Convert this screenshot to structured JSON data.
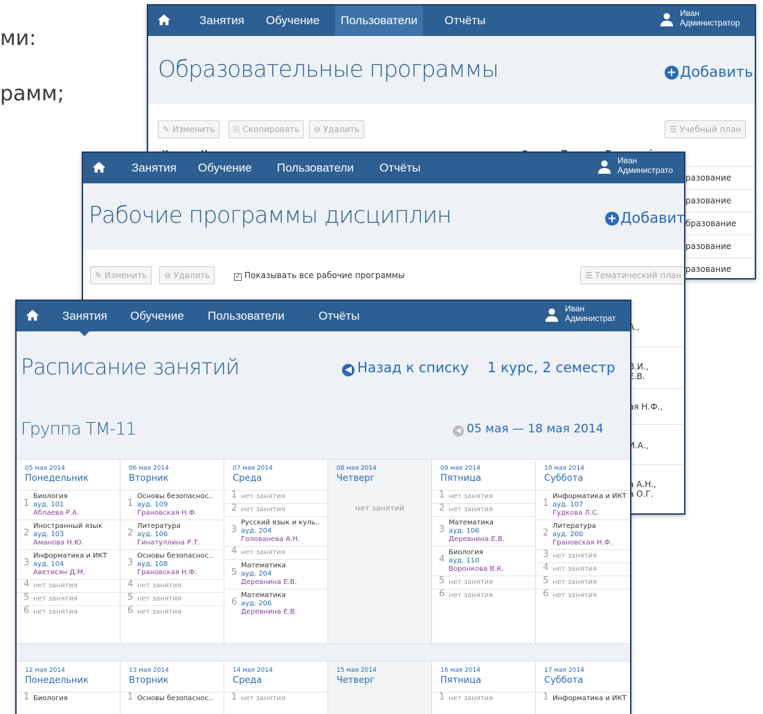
{
  "background": {
    "line1": "ми:",
    "line2": "рамм;"
  },
  "nav": {
    "items": [
      "Занятия",
      "Обучение",
      "Пользователи",
      "Отчёты"
    ],
    "user_first": "Иван",
    "user_second": "Администратор",
    "user_second_short": "Администрат",
    "user_second_mid": "Администрато"
  },
  "win1": {
    "title": "Образовательные программы",
    "add": "Добавить",
    "btn_edit": "Изменить",
    "btn_copy": "Скопировать",
    "btn_delete": "Удалить",
    "btn_plan": "Учебный план",
    "headers": {
      "code": "Код",
      "name": "Название программы",
      "form": "Форма",
      "prep": "Подгот.",
      "base": "База приёма"
    },
    "rows": [
      "разование",
      "разование",
      "бразование",
      "разование",
      "разование"
    ]
  },
  "win2": {
    "title": "Рабочие программы дисциплин",
    "add": "Добавить",
    "btn_edit": "Изменить",
    "btn_delete": "Удалить",
    "checkbox_label": "Показывать все рабочие программы",
    "btn_plan": "Тематический план",
    "cells": [
      "А.,",
      "В.И.,",
      "Е.В.",
      "ая Н.Ф.,",
      "И.А.,",
      "а А.Н.,",
      "а О.Г."
    ]
  },
  "win3": {
    "title": "Расписание занятий",
    "back": "Назад к списку",
    "course": "1 курс, 2 семестр",
    "group": "Группа ТМ-11",
    "range": "05 мая — 18 мая 2014"
  },
  "week1": [
    {
      "date": "05 мая 2014",
      "day": "Понедельник",
      "lessons": [
        {
          "n": "1",
          "subject": "Биология",
          "room": "ауд. 101",
          "teacher": "Аблаева Р.А."
        },
        {
          "n": "2",
          "subject": "Иностранный язык",
          "room": "ауд. 103",
          "teacher": "Аманова Н.Ю."
        },
        {
          "n": "3",
          "subject": "Информатика и ИКТ",
          "room": "ауд. 104",
          "teacher": "Аветисян Д.М."
        },
        {
          "n": "4",
          "none": "нет занятия"
        },
        {
          "n": "5",
          "none": "нет занятия"
        },
        {
          "n": "6",
          "none": "нет занятия"
        }
      ]
    },
    {
      "date": "06 мая 2014",
      "day": "Вторник",
      "lessons": [
        {
          "n": "1",
          "subject": "Основы безопаснос..",
          "room": "ауд. 109",
          "teacher": "Грановская Н.Ф."
        },
        {
          "n": "2",
          "subject": "Литература",
          "room": "ауд. 106",
          "teacher": "Гинатуллина Р.Т."
        },
        {
          "n": "3",
          "subject": "Основы безопаснос..",
          "room": "ауд. 108",
          "teacher": "Грановская Н.Ф."
        },
        {
          "n": "4",
          "none": "нет занятия"
        },
        {
          "n": "5",
          "none": "нет занятия"
        },
        {
          "n": "6",
          "none": "нет занятия"
        }
      ]
    },
    {
      "date": "07 мая 2014",
      "day": "Среда",
      "lessons": [
        {
          "n": "1",
          "none": "нет занятия"
        },
        {
          "n": "2",
          "none": "нет занятия"
        },
        {
          "n": "3",
          "subject": "Русский язык и куль..",
          "room": "ауд. 204",
          "teacher": "Голованева А.Н."
        },
        {
          "n": "4",
          "none": "нет занятия"
        },
        {
          "n": "5",
          "subject": "Математика",
          "room": "ауд. 204",
          "teacher": "Деревнина Е.В."
        },
        {
          "n": "6",
          "subject": "Математика",
          "room": "ауд. 206",
          "teacher": "Деревнина Е.В."
        }
      ]
    },
    {
      "date": "08 мая 2014",
      "day": "Четверг",
      "empty": "нет занятий",
      "lessons": []
    },
    {
      "date": "09 мая 2014",
      "day": "Пятница",
      "lessons": [
        {
          "n": "1",
          "none": "нет занятия"
        },
        {
          "n": "2",
          "none": "нет занятия"
        },
        {
          "n": "3",
          "subject": "Математика",
          "room": "ауд. 106",
          "teacher": "Деревнина Е.В."
        },
        {
          "n": "4",
          "subject": "Биология",
          "room": "ауд. 110",
          "teacher": "Воронкова В.К."
        },
        {
          "n": "5",
          "none": "нет занятия"
        },
        {
          "n": "6",
          "none": "нет занятия"
        }
      ]
    },
    {
      "date": "10 мая 2014",
      "day": "Суббота",
      "lessons": [
        {
          "n": "1",
          "subject": "Информатика и ИКТ",
          "room": "ауд. 107",
          "teacher": "Гудкова Л.С."
        },
        {
          "n": "2",
          "subject": "Литература",
          "room": "ауд. 200",
          "teacher": "Грановская Н.Ф."
        },
        {
          "n": "3",
          "none": "нет занятия"
        },
        {
          "n": "4",
          "none": "нет занятия"
        },
        {
          "n": "5",
          "none": "нет занятия"
        },
        {
          "n": "6",
          "none": "нет занятия"
        }
      ]
    }
  ],
  "week2": [
    {
      "date": "12 мая 2014",
      "day": "Понедельник",
      "lessons": [
        {
          "n": "1",
          "subject": "Биология"
        }
      ]
    },
    {
      "date": "13 мая 2014",
      "day": "Вторник",
      "lessons": [
        {
          "n": "1",
          "subject": "Основы безопаснос.."
        }
      ]
    },
    {
      "date": "14 мая 2014",
      "day": "Среда",
      "lessons": [
        {
          "n": "1",
          "none": "нет занятия"
        }
      ]
    },
    {
      "date": "15 мая 2014",
      "day": "Четверг",
      "lessons": []
    },
    {
      "date": "16 мая 2014",
      "day": "Пятница",
      "lessons": [
        {
          "n": "1",
          "none": "нет занятия"
        }
      ]
    },
    {
      "date": "17 мая 2014",
      "day": "Суббота",
      "lessons": [
        {
          "n": "1",
          "subject": "Информатика и ИКТ"
        }
      ]
    }
  ],
  "colors": {
    "nav": "#2d5f93",
    "accent": "#2a69b8",
    "teacher": "#8b3fa0"
  },
  "icons": [
    "home-icon",
    "user-icon",
    "plus-circle-icon",
    "arrow-left-circle-icon",
    "pencil-icon",
    "copy-icon",
    "minus-circle-icon",
    "list-icon",
    "checkbox-icon"
  ]
}
